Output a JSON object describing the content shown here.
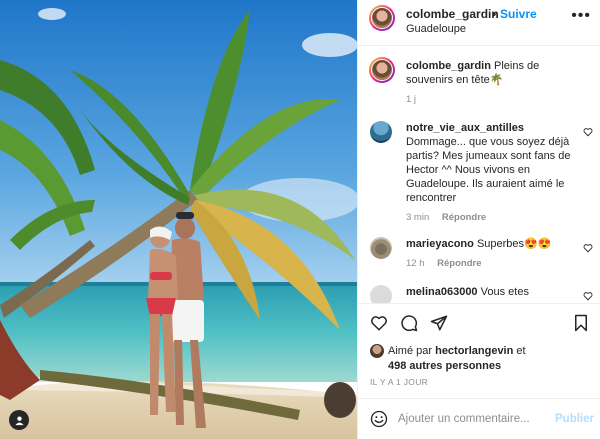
{
  "header": {
    "username": "colombe_gardin",
    "dot": "•",
    "follow_label": "Suivre",
    "location": "Guadeloupe",
    "more_icon": "more-horizontal-icon"
  },
  "caption": {
    "username": "colombe_gardin",
    "text": "Pleins de souvenirs en tête🌴",
    "age": "1 j"
  },
  "comments": [
    {
      "username": "notre_vie_aux_antilles",
      "text": "Dommage... que vous soyez déjà partis? Mes jumeaux sont fans de Hector ^^ Nous vivons en Guadeloupe. Ils auraient aimé le rencontrer",
      "age": "3 min",
      "reply": "Répondre"
    },
    {
      "username": "marieyacono",
      "text": "Superbes😍😍",
      "age": "12 h",
      "reply": "Répondre"
    },
    {
      "username": "melina063000",
      "text": "Vous etes"
    }
  ],
  "actions": {
    "like_icon": "heart-icon",
    "comment_icon": "comment-icon",
    "share_icon": "paper-plane-icon",
    "save_icon": "bookmark-icon"
  },
  "likes": {
    "prefix": "Aimé par",
    "user": "hectorlangevin",
    "conj": "et",
    "others": "498 autres personnes"
  },
  "timestamp": "IL Y A 1 JOUR",
  "add_comment": {
    "placeholder": "Ajouter un commentaire...",
    "publish_label": "Publier",
    "emoji_icon": "smiley-icon"
  },
  "colors": {
    "link_blue": "#0095f6",
    "publish_disabled": "#b2dffc",
    "muted": "#8e8e8e"
  }
}
